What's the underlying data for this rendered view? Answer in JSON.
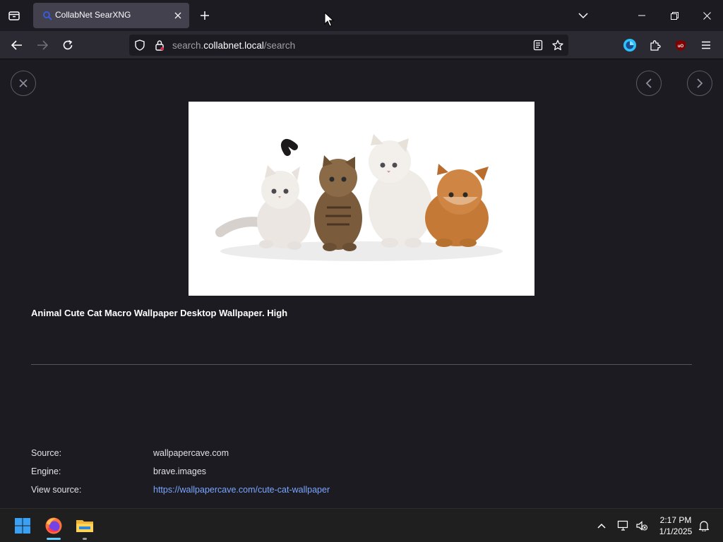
{
  "browser": {
    "tab": {
      "title": "CollabNet SearXNG",
      "close_icon": "close-icon",
      "favicon": "search-favicon"
    },
    "url": {
      "prefix": "search.",
      "host": "collabnet.local",
      "path": "/search"
    }
  },
  "viewer": {
    "title": "Animal Cute Cat Macro Wallpaper Desktop Wallpaper. High",
    "image_alt": "Five kittens on white background",
    "meta": [
      {
        "label": "Source:",
        "value": "wallpapercave.com"
      },
      {
        "label": "Engine:",
        "value": "brave.images"
      },
      {
        "label": "View source:",
        "value": "https://wallpapercave.com/cute-cat-wallpaper"
      }
    ]
  },
  "taskbar": {
    "time": "2:17 PM",
    "date": "1/1/2025"
  },
  "colors": {
    "accent_link": "#7aa6ff",
    "bg": "#1c1b22",
    "toolbar": "#2b2a33",
    "tab_active": "#42414d"
  }
}
